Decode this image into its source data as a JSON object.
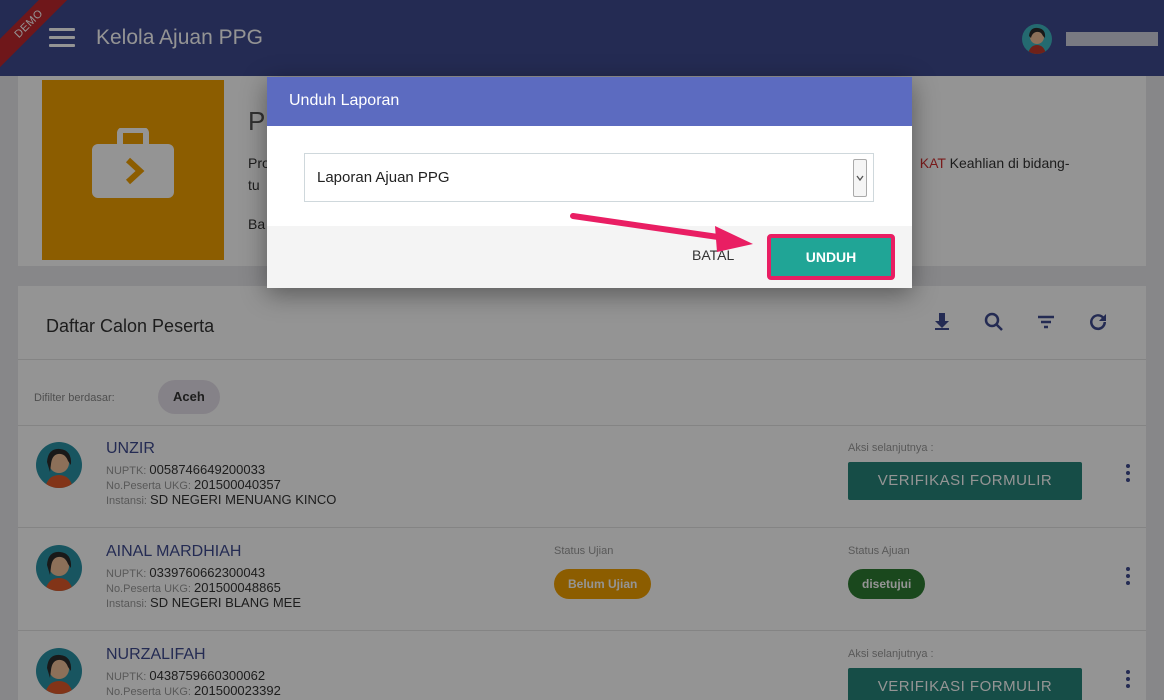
{
  "app": {
    "demo_label": "DEMO",
    "title": "Kelola Ajuan PPG"
  },
  "info": {
    "title_partial": "P",
    "text_left": "Pro",
    "text_left2": "tu",
    "text_red": "KAT",
    "text_right": "Keahlian di bidang-",
    "text_bottom": "Ba"
  },
  "list": {
    "title": "Daftar Calon Peserta",
    "filter_label": "Difilter berdasar:",
    "filter_chip": "Aceh",
    "labels": {
      "nuptk": "NUPTK:",
      "no_peserta": "No.Peserta UKG:",
      "instansi": "Instansi:",
      "aksi": "Aksi selanjutnya :",
      "status_ujian": "Status Ujian",
      "status_ajuan": "Status Ajuan"
    },
    "rows": [
      {
        "name": "UNZIR",
        "nuptk": "0058746649200033",
        "no_peserta": "201500040357",
        "instansi": "SD NEGERI MENUANG KINCO",
        "action": "VERIFIKASI FORMULIR"
      },
      {
        "name": "AINAL MARDHIAH",
        "nuptk": "0339760662300043",
        "no_peserta": "201500048865",
        "instansi": "SD NEGERI BLANG MEE",
        "status_ujian": "Belum Ujian",
        "status_ajuan": "disetujui"
      },
      {
        "name": "NURZALIFAH",
        "nuptk": "0438759660300062",
        "no_peserta": "201500023392",
        "action": "VERIFIKASI FORMULIR"
      }
    ]
  },
  "dialog": {
    "title": "Unduh Laporan",
    "select_value": "Laporan Ajuan PPG",
    "cancel_label": "BATAL",
    "confirm_label": "UNDUH"
  },
  "colors": {
    "topbar": "#3f4a8f",
    "dialog_header": "#5c6bc0",
    "unduh_button": "#20a596",
    "highlight": "#e91e63",
    "verif_button": "#26857a"
  },
  "icons": [
    "menu-icon",
    "avatar",
    "briefcase-icon",
    "download-icon",
    "search-icon",
    "filter-icon",
    "refresh-icon",
    "more-vert-icon",
    "chevron-down-icon",
    "arrow-annotation"
  ]
}
